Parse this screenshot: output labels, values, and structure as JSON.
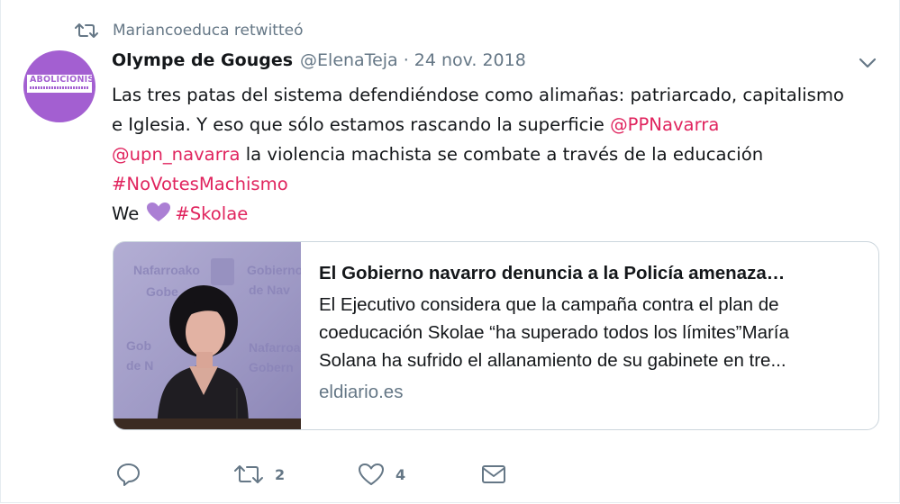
{
  "retweet_context": {
    "icon": "retweet-icon",
    "text": "Mariancoeduca retwitteó"
  },
  "author": {
    "avatar_text": "ABOLICIONISTA",
    "avatar_color": "#a35fd1",
    "name": "Olympe de Gouges",
    "handle": "@ElenaTeja",
    "separator": "·",
    "date": "24 nov. 2018"
  },
  "tweet": {
    "line1": "Las tres patas del sistema defendiéndose como alimañas: patriarcado, capitalismo",
    "line2_text": "e Iglesia. Y eso que sólo estamos rascando la superficie ",
    "mention1": "@PPNavarra",
    "mention2": "@upn_navarra",
    "line3_text": " la violencia machista se combate a través de la educación",
    "hashtag1": "#NoVotesMachismo",
    "we": "We",
    "emoji": "purple-heart-icon",
    "hashtag2": "#Skolae"
  },
  "card": {
    "title": "El Gobierno navarro denuncia a la Policía amenaza…",
    "desc_line1": "El Ejecutivo considera que la campaña contra el plan de",
    "desc_line2": "coeducación Skolae “ha superado todos los límites”María",
    "desc_line3": "Solana ha sufrido el allanamiento de su gabinete en tre...",
    "domain": "eldiario.es",
    "image_sign_text": "Gobierno de Navarra"
  },
  "actions": {
    "reply": {
      "icon": "reply-icon",
      "count": ""
    },
    "retweet": {
      "icon": "retweet-icon",
      "count": "2"
    },
    "like": {
      "icon": "heart-icon",
      "count": "4"
    },
    "dm": {
      "icon": "mail-icon",
      "count": ""
    }
  },
  "colors": {
    "link": "#e0245e",
    "muted": "#657786",
    "text": "#14171a",
    "border": "#ccd6dd",
    "accent_purple": "#a35fd1"
  }
}
